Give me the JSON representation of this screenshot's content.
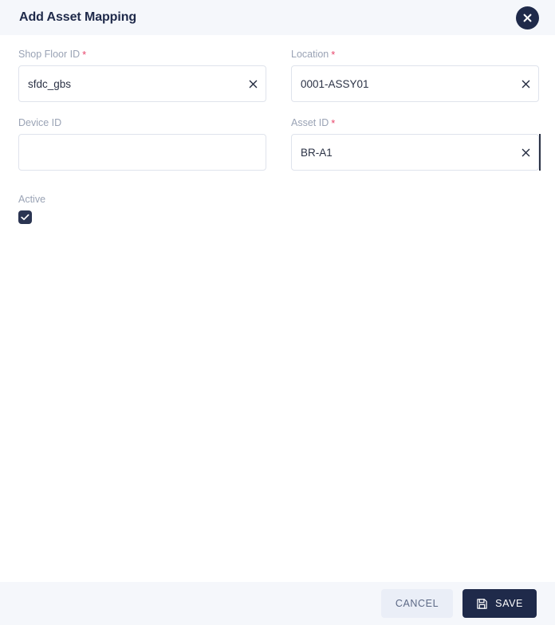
{
  "dialog": {
    "title": "Add Asset Mapping",
    "close_icon": "close-icon"
  },
  "form": {
    "fields": [
      {
        "label": "Shop Floor ID",
        "required": true,
        "required_mark": "*",
        "value": "sfdc_gbs",
        "placeholder": "",
        "has_clear": true,
        "clear_icon": "clear-icon"
      },
      {
        "label": "Location",
        "required": true,
        "required_mark": "*",
        "value": "0001-ASSY01",
        "placeholder": "",
        "has_clear": true,
        "clear_icon": "clear-icon"
      },
      {
        "label": "Device ID",
        "required": false,
        "required_mark": "",
        "value": "",
        "placeholder": "",
        "has_clear": false,
        "clear_icon": ""
      },
      {
        "label": "Asset ID",
        "required": true,
        "required_mark": "*",
        "value": "BR-A1",
        "placeholder": "",
        "has_clear": true,
        "clear_icon": "clear-icon"
      }
    ],
    "active": {
      "label": "Active",
      "checked": true,
      "check_icon": "checkmark-icon"
    }
  },
  "footer": {
    "cancel_label": "CANCEL",
    "save_label": "SAVE",
    "save_icon": "save-floppy-icon"
  },
  "colors": {
    "header_bg": "#f5f7fb",
    "footer_bg": "#f5f7fb",
    "title": "#1f2a4a",
    "label": "#9aa3b5",
    "required_star": "#e8456b",
    "input_border": "#dfe3ec",
    "input_text": "#2b3245",
    "accent_dark": "#1f2a4a",
    "checkbox_bg": "#2b3552",
    "cancel_bg": "#eaeef7",
    "cancel_text": "#5c6885"
  }
}
